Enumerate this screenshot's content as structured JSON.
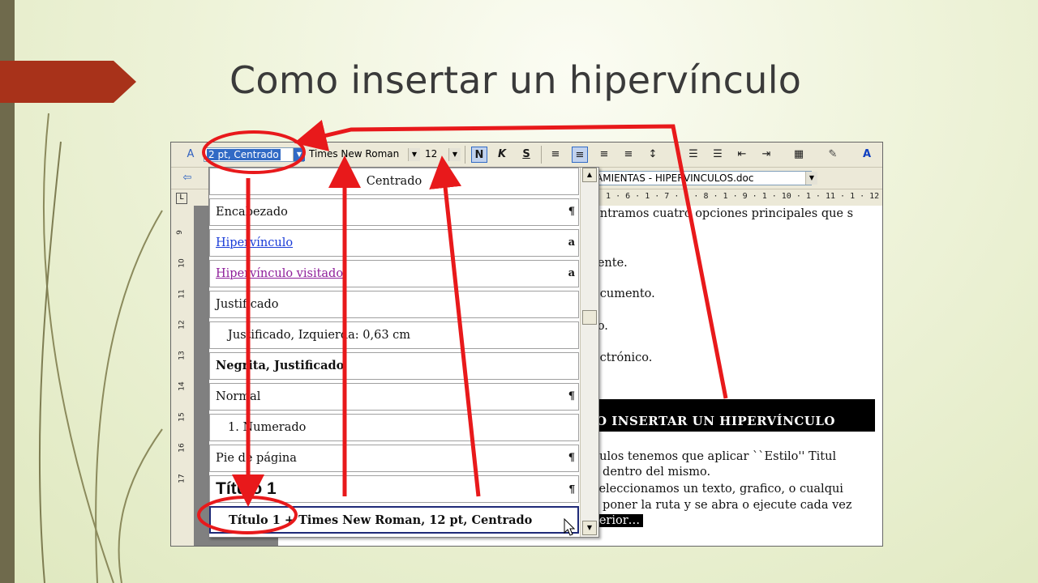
{
  "slide": {
    "title": "Como insertar un hipervínculo",
    "accent_color": "#a8321a",
    "band_color": "#6f6a4c"
  },
  "toolbar": {
    "style_value": "2 pt, Centrado",
    "font_value": "Times New Roman",
    "size_value": "12",
    "bold_label": "N",
    "italic_label": "K",
    "underline_label": "S",
    "document_path": "AMIENTAS - HIPERVINCULOS.doc"
  },
  "ruler": {
    "horizontal": "· 1 · 6 · 1 · 7 · 1 · 8 · 1 · 9 · 1 · 10 · 1 · 11 · 1 · 12",
    "vertical": [
      "9",
      "10",
      "11",
      "12",
      "13",
      "14",
      "15",
      "16",
      "17"
    ]
  },
  "style_list": [
    {
      "label": "Centrado",
      "mark": ""
    },
    {
      "label": "Encabezado",
      "mark": "¶"
    },
    {
      "label": "Hipervínculo",
      "mark": "a"
    },
    {
      "label": "Hipervínculo visitado",
      "mark": "a"
    },
    {
      "label": "Justificado",
      "mark": ""
    },
    {
      "label": "Justificado, Izquierda:  0,63 cm",
      "mark": ""
    },
    {
      "label": "Negrita, Justificado",
      "mark": ""
    },
    {
      "label": "Normal",
      "mark": "¶"
    },
    {
      "label": "1.   Numerado",
      "mark": ""
    },
    {
      "label": "Pie de página",
      "mark": "¶"
    },
    {
      "label": "Título 1",
      "mark": "¶"
    },
    {
      "label": "Título 1 + Times New Roman, 12 pt, Centrado",
      "mark": ""
    }
  ],
  "document": {
    "lines": [
      "ontramos cuatro opciones principales que s",
      "tente.",
      "ocumento.",
      "to.",
      "ectrónico."
    ],
    "heading": "O INSERTAR UN HIPERVÍNCULO",
    "body": [
      "culos tenemos que aplicar ``Estilo'' Titul",
      "s dentro del mismo.",
      "seleccionamos un texto, grafico, o cualqui",
      "s poner la ruta y se abra o ejecute cada vez"
    ],
    "selected": "terior…"
  },
  "annotation_color": "#e8191b"
}
